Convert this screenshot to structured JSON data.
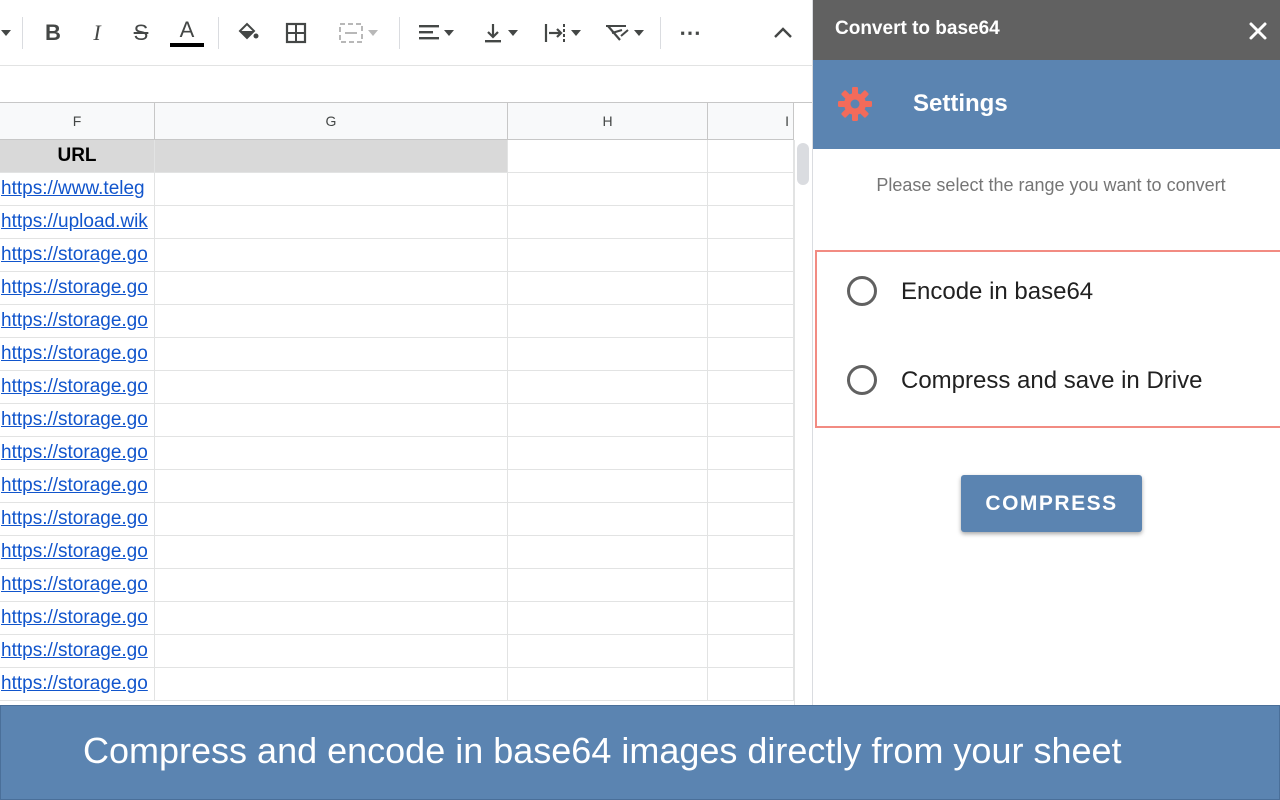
{
  "toolbar": {
    "buttons": [
      {
        "name": "bold-icon",
        "glyph": "B"
      },
      {
        "name": "italic-icon",
        "glyph": "I"
      },
      {
        "name": "strikethrough-icon",
        "glyph": "S"
      },
      {
        "name": "text-color-icon",
        "glyph": "A"
      }
    ],
    "text_color_swatch": "#000000",
    "more_label": "⋯"
  },
  "grid": {
    "columns": [
      "F",
      "G",
      "H",
      "I"
    ],
    "header_row": {
      "F": "URL"
    },
    "url_cells": [
      "https://www.teleg",
      "https://upload.wik",
      "https://storage.go",
      "https://storage.go",
      "https://storage.go",
      "https://storage.go",
      "https://storage.go",
      "https://storage.go",
      "https://storage.go",
      "https://storage.go",
      "https://storage.go",
      "https://storage.go",
      "https://storage.go",
      "https://storage.go",
      "https://storage.go",
      "https://storage.go"
    ]
  },
  "sidebar": {
    "title": "Convert to base64",
    "close_glyph": "✕",
    "settings_label": "Settings",
    "hint": "Please select the range you want to convert",
    "options": [
      {
        "label": "Encode in base64",
        "selected": false
      },
      {
        "label": "Compress and save in Drive",
        "selected": false
      }
    ],
    "action_button": "COMPRESS"
  },
  "caption": "Compress and encode in base64 images directly from your sheet",
  "colors": {
    "accent": "#5b84b1",
    "titlebar": "#616161",
    "gear": "#f26b5b",
    "option_border": "#f28b82",
    "link": "#1155cc"
  }
}
